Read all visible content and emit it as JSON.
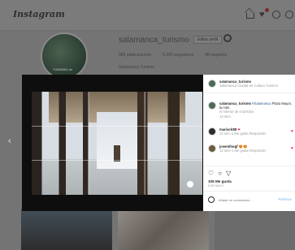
{
  "topbar": {
    "logo": "Instagram"
  },
  "profile": {
    "username": "salamanca_turismo",
    "edit_button": "Editar perfil",
    "avatar_text": "TURISMO de",
    "stats": [
      "989 publicaciones",
      "5.325 seguidores",
      "88 seguidos"
    ],
    "full_name": "Salamanca Turismo"
  },
  "modal": {
    "caption": {
      "username": "salamanca_turismo",
      "subtitle": "Salamanca Ciudad de Cultura Turismo"
    },
    "comments": [
      {
        "username": "salamanca_turismo",
        "text": "Plaza Mayor, la más",
        "hashtag": "#Salamanca",
        "extra": "el Interior de el destino",
        "meta": "13 sem"
      },
      {
        "username": "marisolr88",
        "text": "❤",
        "meta": "12 sem   1 Me gusta   Responder"
      },
      {
        "username": "josemfnogf",
        "text": "😍😍",
        "meta": "12 sem   1 Me gusta   Responder"
      }
    ],
    "likes": "105 Me gusta",
    "date": "6 DE MAYO",
    "comment_placeholder": "Añade un comentario...",
    "post_label": "Publicar"
  }
}
